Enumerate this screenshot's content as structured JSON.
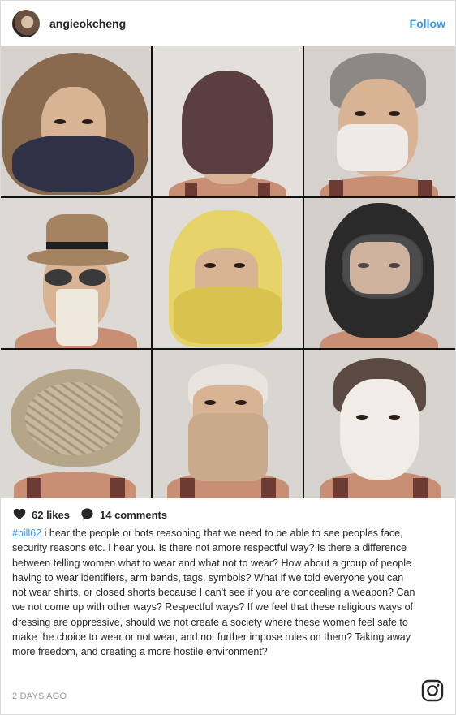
{
  "post": {
    "username": "angieokcheng",
    "follow_label": "Follow",
    "likes": "62 likes",
    "comments": "14 comments",
    "caption_hashtag": "#bill62",
    "caption_text": " i hear the people or bots reasoning that we need to be able to see peoples face, security reasons etc. I hear you. Is there not amore respectful way? Is there a difference between telling women what to wear and what not to wear? How about a group of people having to wear identifiers, arm bands, tags, symbols? What if we told everyone you can not wear shirts, or closed shorts because I can't see if you are concealing a weapon? Can we not come up with other ways? Respectful ways? If we feel that these religious ways of dressing are oppressive, should we not create a society where these women feel safe to make the choice to wear or not wear, and not further impose rules on them? Taking away more freedom, and creating a more hostile environment?",
    "date": "2 DAYS AGO"
  },
  "photo_grid": {
    "tiles": [
      {
        "covering": "fur-hood-and-scarf",
        "bg": "#d7d2cd"
      },
      {
        "covering": "knit-beanie",
        "bg": "#e3e0dc"
      },
      {
        "covering": "surgical-mask",
        "bg": "#d6d1cc"
      },
      {
        "covering": "fedora-sunglasses-coffee-cup",
        "bg": "#ddd9d4"
      },
      {
        "covering": "yellow-scarf",
        "bg": "#e0ddd8"
      },
      {
        "covering": "motorcycle-helmet",
        "bg": "#d4cfca"
      },
      {
        "covering": "paper-mache-head",
        "bg": "#dcd8d3"
      },
      {
        "covering": "beige-wrap",
        "bg": "#d9d5d0"
      },
      {
        "covering": "sheet-face-mask",
        "bg": "#d7d3ce"
      }
    ]
  },
  "colors": {
    "link": "#3897f0",
    "text": "#262626",
    "muted": "#999999",
    "border": "#dbdbdb"
  },
  "icons": [
    "heart-icon",
    "comment-icon",
    "instagram-icon"
  ]
}
